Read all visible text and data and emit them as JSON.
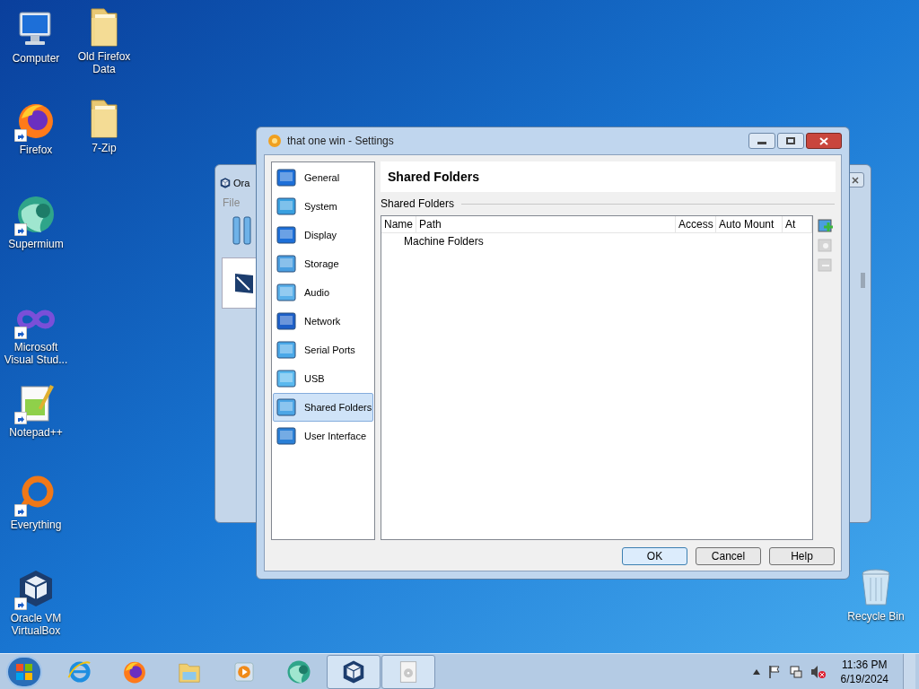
{
  "desktop_icons": [
    {
      "label": "Computer",
      "kind": "computer",
      "shortcut": false
    },
    {
      "label": "Old Firefox Data",
      "kind": "folder",
      "shortcut": false
    },
    {
      "label": "Firefox",
      "kind": "firefox",
      "shortcut": true
    },
    {
      "label": "7-Zip",
      "kind": "folder",
      "shortcut": false
    },
    {
      "label": "Supermium",
      "kind": "supermium",
      "shortcut": true
    },
    {
      "label": "Microsoft Visual Stud...",
      "kind": "infinity",
      "shortcut": true
    },
    {
      "label": "Notepad++",
      "kind": "notepad",
      "shortcut": true
    },
    {
      "label": "Everything",
      "kind": "ring",
      "shortcut": true
    },
    {
      "label": "Oracle VM VirtualBox",
      "kind": "cube",
      "shortcut": true
    },
    {
      "label": "Recycle Bin",
      "kind": "bin",
      "shortcut": false
    }
  ],
  "background_window": {
    "title": "Ora",
    "menu": [
      "File"
    ]
  },
  "dialog": {
    "title": "that one win - Settings",
    "categories": [
      {
        "label": "General",
        "selected": false
      },
      {
        "label": "System",
        "selected": false
      },
      {
        "label": "Display",
        "selected": false
      },
      {
        "label": "Storage",
        "selected": false
      },
      {
        "label": "Audio",
        "selected": false
      },
      {
        "label": "Network",
        "selected": false
      },
      {
        "label": "Serial Ports",
        "selected": false
      },
      {
        "label": "USB",
        "selected": false
      },
      {
        "label": "Shared Folders",
        "selected": true
      },
      {
        "label": "User Interface",
        "selected": false
      }
    ],
    "page_title": "Shared Folders",
    "group_label": "Shared Folders",
    "columns": [
      "Name",
      "Path",
      "Access",
      "Auto Mount",
      "At"
    ],
    "rows": [
      {
        "label": "Machine Folders"
      }
    ],
    "tools": [
      {
        "kind": "add",
        "disabled": false
      },
      {
        "kind": "edit",
        "disabled": true
      },
      {
        "kind": "remove",
        "disabled": true
      }
    ],
    "buttons": [
      {
        "label": "OK",
        "default": true
      },
      {
        "label": "Cancel",
        "default": false
      },
      {
        "label": "Help",
        "default": false
      }
    ]
  },
  "taskbar": {
    "apps": [
      {
        "kind": "ie",
        "open": false
      },
      {
        "kind": "firefox",
        "open": false
      },
      {
        "kind": "explorer",
        "open": false
      },
      {
        "kind": "media",
        "open": false
      },
      {
        "kind": "supermium",
        "open": false
      },
      {
        "kind": "cube",
        "open": true
      },
      {
        "kind": "disc",
        "open": true
      }
    ],
    "time": "11:36 PM",
    "date": "6/19/2024"
  }
}
